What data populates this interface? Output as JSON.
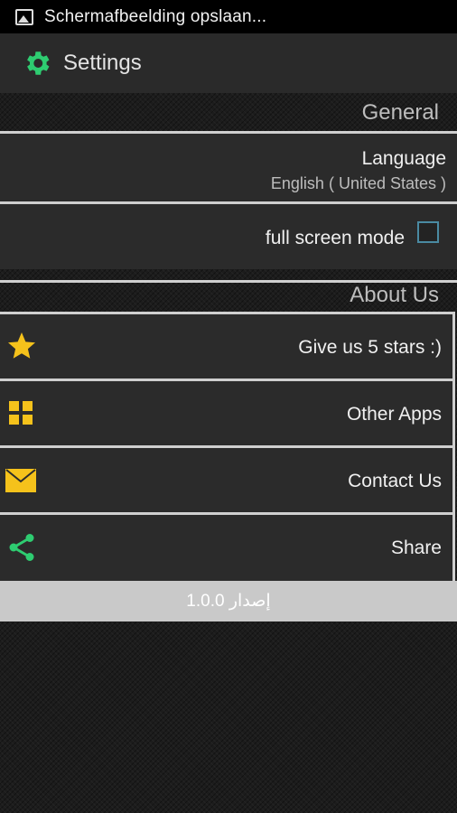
{
  "status_bar": {
    "notification_text": "Schermafbeelding opslaan..."
  },
  "action_bar": {
    "title": "Settings",
    "icon": "gear-icon"
  },
  "sections": {
    "general": {
      "header": "General",
      "language": {
        "title": "Language",
        "value": "English ( United States )"
      },
      "fullscreen": {
        "label": "full screen mode",
        "checked": false
      }
    },
    "about": {
      "header": "About Us",
      "items": [
        {
          "label": "Give us 5 stars :)",
          "icon": "star-icon"
        },
        {
          "label": "Other Apps",
          "icon": "grid-icon"
        },
        {
          "label": "Contact Us",
          "icon": "mail-icon"
        },
        {
          "label": "Share",
          "icon": "share-icon"
        }
      ]
    }
  },
  "version": {
    "text": "إصدار 1.0.0"
  },
  "colors": {
    "accent_yellow": "#f5c21b",
    "accent_green": "#2ecc71",
    "checkbox_border": "#4a8aa2"
  }
}
